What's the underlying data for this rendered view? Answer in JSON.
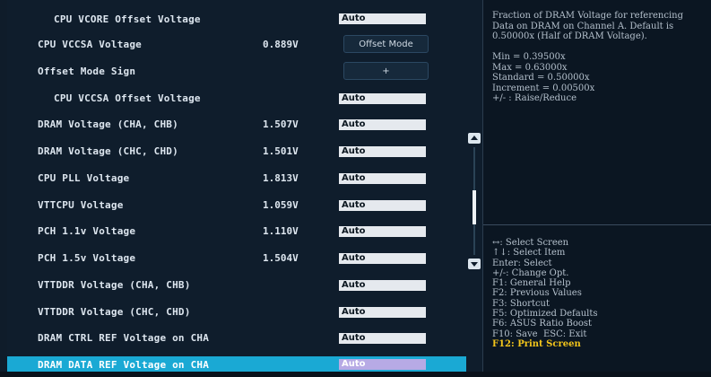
{
  "rows": [
    {
      "label": "CPU VCORE Offset Voltage",
      "value": "",
      "control": "Auto"
    },
    {
      "label": "CPU VCCSA Voltage",
      "value": "0.889V",
      "control": "Offset Mode"
    },
    {
      "label": "Offset Mode Sign",
      "value": "",
      "control": "+"
    },
    {
      "label": "CPU VCCSA Offset Voltage",
      "value": "",
      "control": "Auto"
    },
    {
      "label": "DRAM Voltage (CHA, CHB)",
      "value": "1.507V",
      "control": "Auto"
    },
    {
      "label": "DRAM Voltage (CHC, CHD)",
      "value": "1.501V",
      "control": "Auto"
    },
    {
      "label": "CPU PLL Voltage",
      "value": "1.813V",
      "control": "Auto"
    },
    {
      "label": "VTTCPU Voltage",
      "value": "1.059V",
      "control": "Auto"
    },
    {
      "label": "PCH 1.1v Voltage",
      "value": "1.110V",
      "control": "Auto"
    },
    {
      "label": "PCH 1.5v Voltage",
      "value": "1.504V",
      "control": "Auto"
    },
    {
      "label": "VTTDDR Voltage (CHA, CHB)",
      "value": "",
      "control": "Auto"
    },
    {
      "label": "VTTDDR Voltage (CHC, CHD)",
      "value": "",
      "control": "Auto"
    },
    {
      "label": "DRAM CTRL REF Voltage on CHA",
      "value": "",
      "control": "Auto"
    },
    {
      "label": "DRAM DATA REF Voltage on CHA",
      "value": "",
      "control": "Auto"
    }
  ],
  "help_text": "Fraction of DRAM Voltage for referencing Data on DRAM on Channel A. Default is 0.50000x (Half of DRAM Voltage).\n\nMin = 0.39500x\nMax = 0.63000x\nStandard = 0.50000x\nIncrement = 0.00500x\n+/- : Raise/Reduce",
  "keys": [
    "↔: Select Screen",
    "↑↓: Select Item",
    "Enter: Select",
    "+/-: Change Opt.",
    "F1: General Help",
    "F2: Previous Values",
    "F3: Shortcut",
    "F5: Optimized Defaults",
    "F6: ASUS Ratio Boost",
    "F10: Save  ESC: Exit",
    "F12: Print Screen"
  ],
  "colors": {
    "selected_row": "#1aa9d4",
    "selected_field": "#b7aae5",
    "highlight_key": "#f3c51b"
  }
}
